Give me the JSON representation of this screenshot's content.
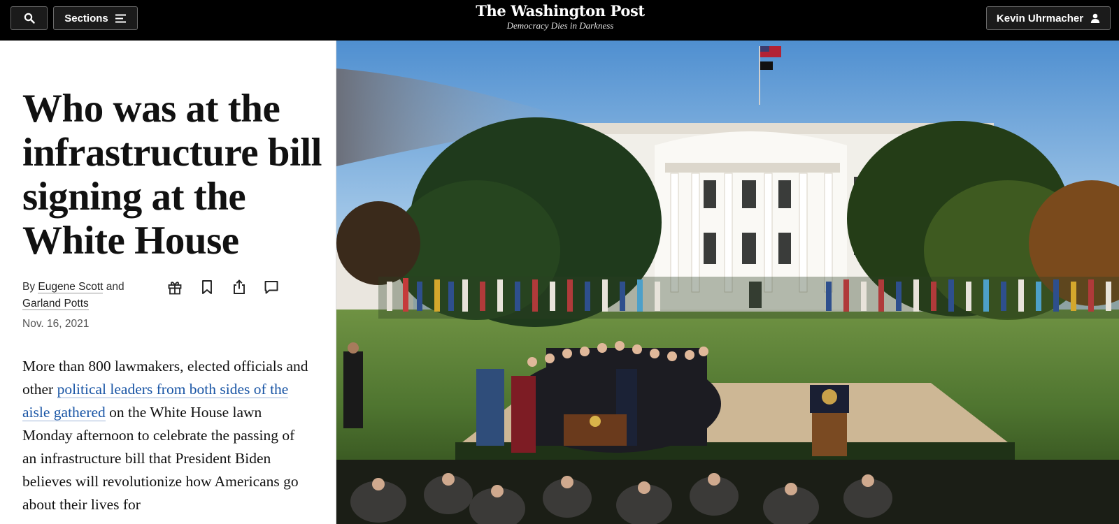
{
  "header": {
    "search_icon": "search-icon",
    "sections_label": "Sections",
    "menu_icon": "hamburger-menu-icon",
    "logo_text": "The Washington Post",
    "tagline": "Democracy Dies in Darkness",
    "user_name": "Kevin Uhrmacher",
    "user_icon": "person-icon",
    "background_color": "#000000"
  },
  "article": {
    "headline": "Who was at the infrastructure bill signing at the White House",
    "byline": {
      "prefix": "By",
      "author1": "Eugene Scott",
      "joiner": "and",
      "author2": "Garland Potts"
    },
    "share_icons": [
      "gift-icon",
      "bookmark-icon",
      "share-icon",
      "comment-icon"
    ],
    "date": "Nov. 16, 2021",
    "body": {
      "before_link": "More than 800 lawmakers, elected officials and other",
      "link_text": "political leaders from both sides of the aisle gathered",
      "after_link": "on the White House lawn Monday afternoon to celebrate the passing of an infrastructure bill that President Biden believes will revolutionize how Americans go about their lives for"
    },
    "link_color": "#1955a5"
  },
  "hero_image": {
    "description_icon": "white-house-lawn-photo"
  }
}
